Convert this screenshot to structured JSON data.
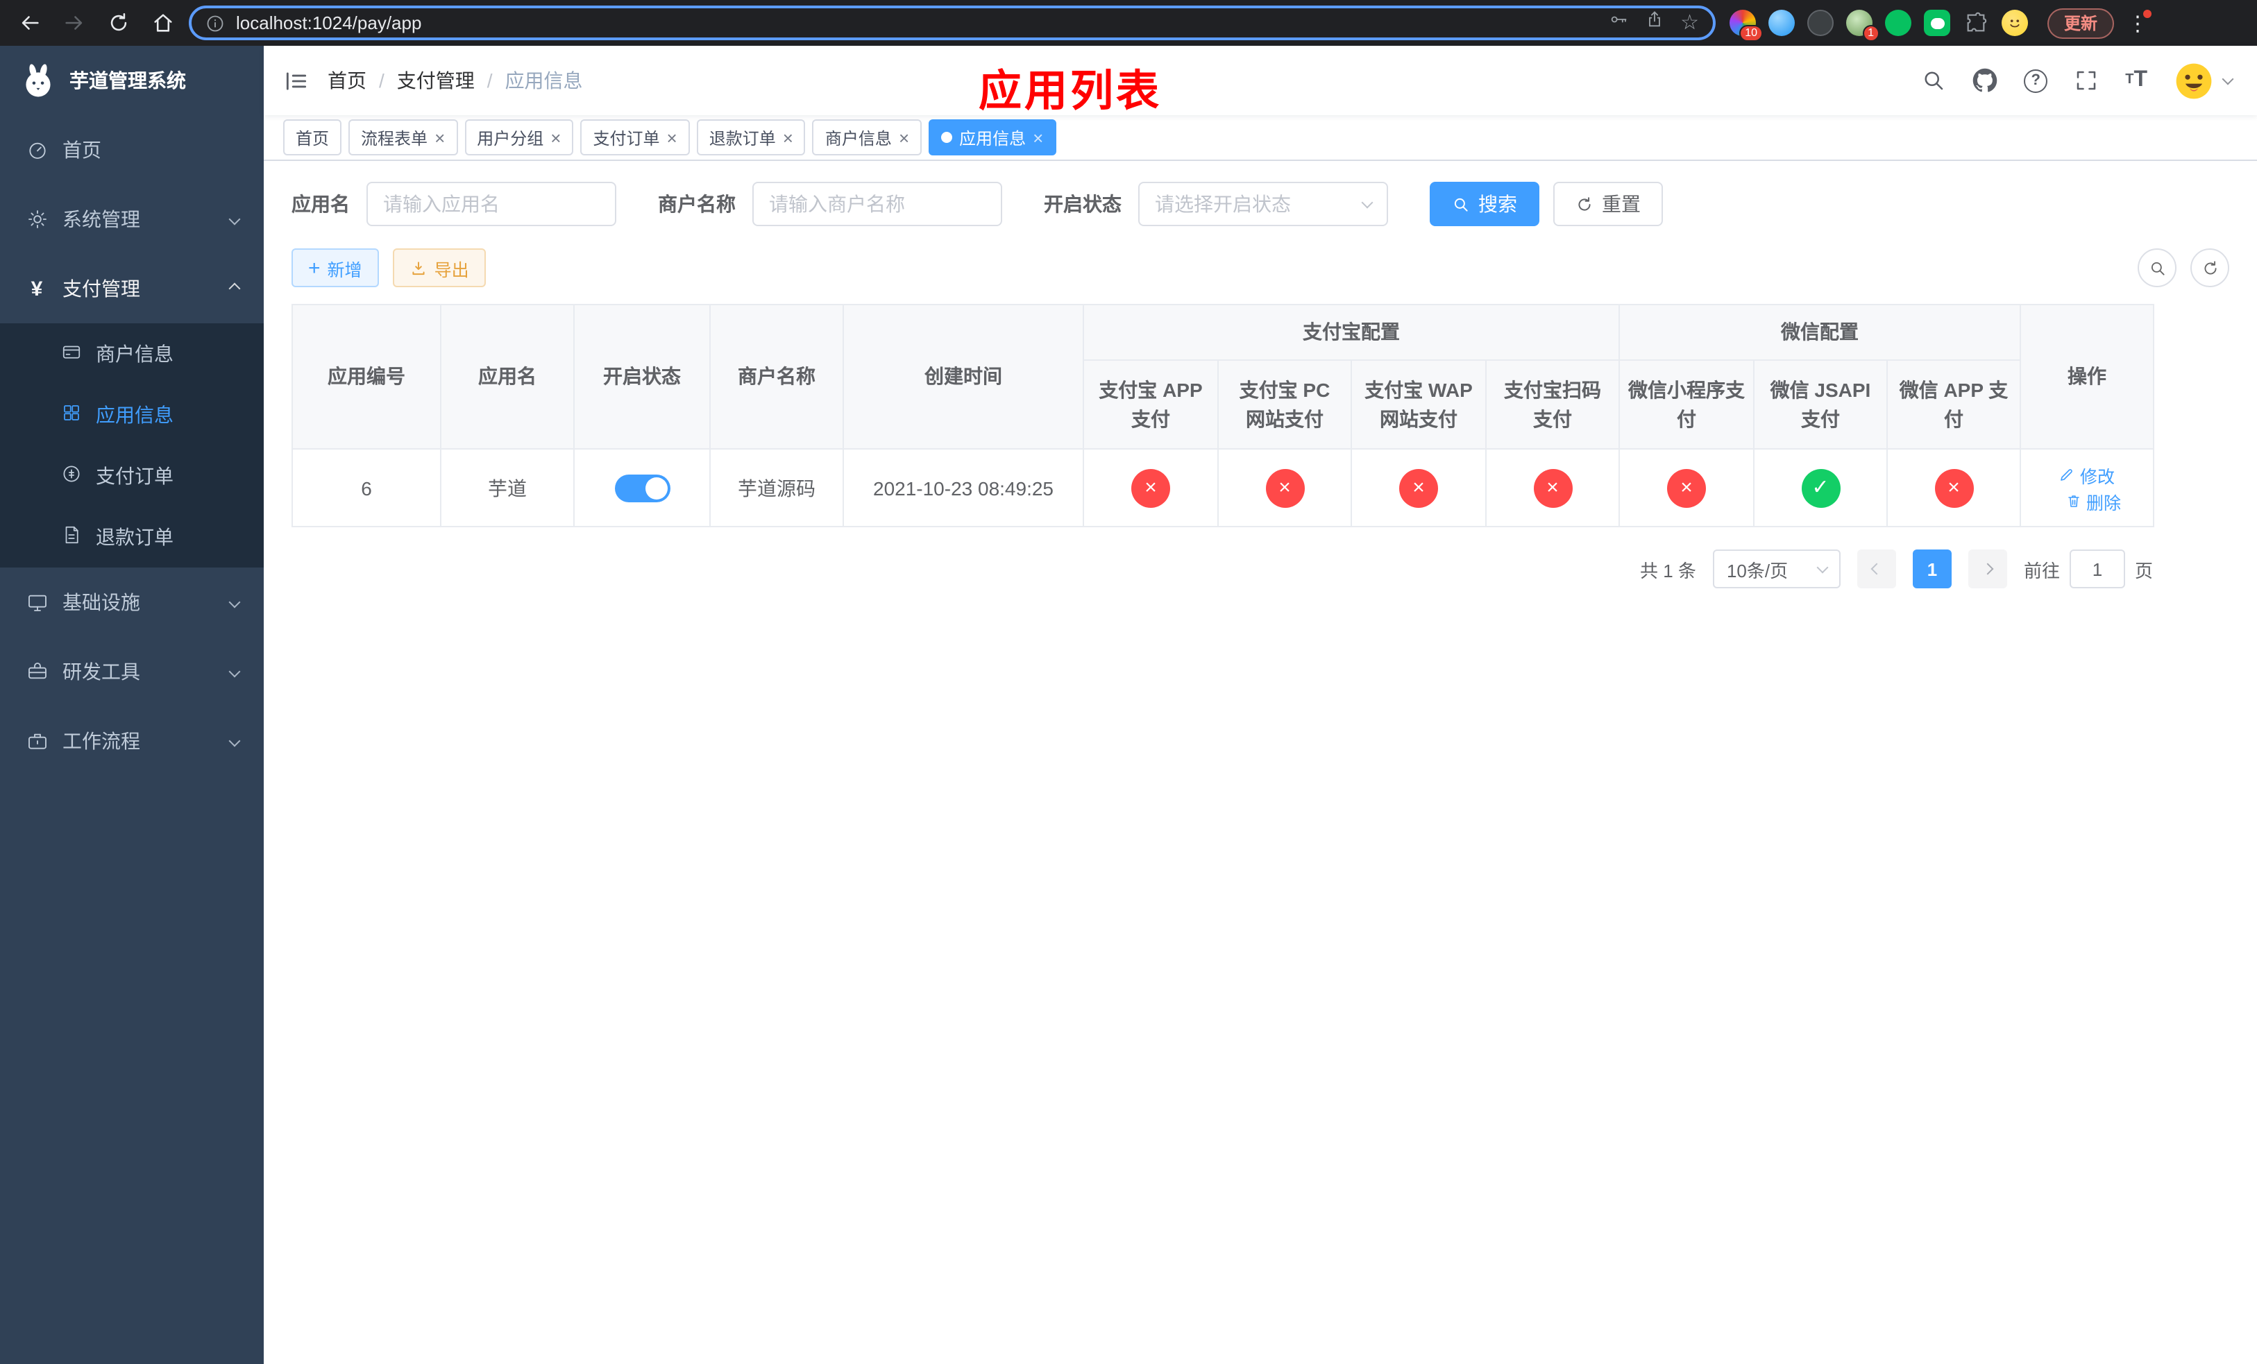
{
  "browser": {
    "url": "localhost:1024/pay/app",
    "update_label": "更新",
    "ext_badge_1": "10",
    "ext_badge_2": "1"
  },
  "sidebar": {
    "title": "芋道管理系统",
    "items": {
      "home": "首页",
      "system": "系统管理",
      "pay": "支付管理",
      "infra": "基础设施",
      "dev": "研发工具",
      "workflow": "工作流程"
    },
    "pay_children": {
      "merchant": "商户信息",
      "app": "应用信息",
      "order": "支付订单",
      "refund": "退款订单"
    }
  },
  "header": {
    "breadcrumb": [
      "首页",
      "支付管理",
      "应用信息"
    ],
    "annotation": "应用列表"
  },
  "tabs": [
    {
      "label": "首页"
    },
    {
      "label": "流程表单"
    },
    {
      "label": "用户分组"
    },
    {
      "label": "支付订单"
    },
    {
      "label": "退款订单"
    },
    {
      "label": "商户信息"
    },
    {
      "label": "应用信息"
    }
  ],
  "filters": {
    "app_name_label": "应用名",
    "app_name_placeholder": "请输入应用名",
    "merchant_label": "商户名称",
    "merchant_placeholder": "请输入商户名称",
    "status_label": "开启状态",
    "status_placeholder": "请选择开启状态",
    "search_label": "搜索",
    "reset_label": "重置"
  },
  "toolbar": {
    "add_label": "新增",
    "export_label": "导出"
  },
  "table": {
    "groups": {
      "alipay": "支付宝配置",
      "wechat": "微信配置"
    },
    "columns": {
      "id": "应用编号",
      "name": "应用名",
      "status": "开启状态",
      "merchant": "商户名称",
      "created": "创建时间",
      "ops": "操作"
    },
    "sub_columns": [
      "支付宝 APP 支付",
      "支付宝 PC 网站支付",
      "支付宝 WAP 网站支付",
      "支付宝扫码支付",
      "微信小程序支付",
      "微信 JSAPI 支付",
      "微信 APP 支付"
    ],
    "row": {
      "id": "6",
      "name": "芋道",
      "status_on": true,
      "merchant": "芋道源码",
      "created": "2021-10-23 08:49:25",
      "configs": [
        false,
        false,
        false,
        false,
        false,
        true,
        false
      ],
      "edit_label": "修改",
      "delete_label": "删除"
    }
  },
  "pagination": {
    "total": "共 1 条",
    "page_size": "10条/页",
    "page": "1",
    "goto_prefix": "前往",
    "goto_suffix": "页",
    "goto_value": "1"
  },
  "colors": {
    "primary": "#409EFF",
    "success": "#13ce66",
    "danger": "#ff4949",
    "annotation": "#ff0000"
  }
}
